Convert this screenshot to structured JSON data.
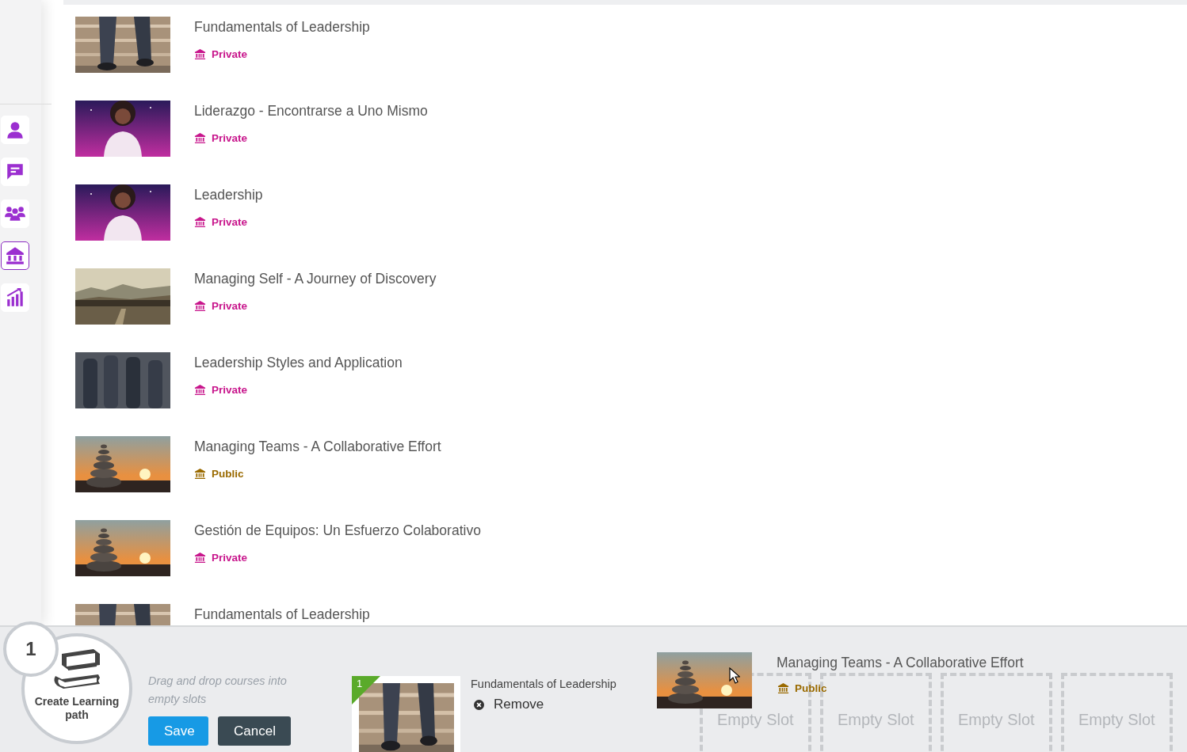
{
  "sidebar": {
    "items": [
      {
        "selected": false
      },
      {
        "selected": false
      },
      {
        "selected": false
      },
      {
        "selected": true
      },
      {
        "selected": false
      }
    ]
  },
  "courses": [
    {
      "title": "Fundamentals of Leadership",
      "visibility": {
        "label": "Private",
        "kind": "private"
      }
    },
    {
      "title": "Liderazgo - Encontrarse a Uno Mismo",
      "visibility": {
        "label": "Private",
        "kind": "private"
      }
    },
    {
      "title": "Leadership",
      "visibility": {
        "label": "Private",
        "kind": "private"
      }
    },
    {
      "title": "Managing Self - A Journey of Discovery",
      "visibility": {
        "label": "Private",
        "kind": "private"
      }
    },
    {
      "title": "Leadership Styles and Application",
      "visibility": {
        "label": "Private",
        "kind": "private"
      }
    },
    {
      "title": "Managing Teams - A Collaborative Effort",
      "visibility": {
        "label": "Public",
        "kind": "public"
      }
    },
    {
      "title": "Gestión de Equipos: Un Esfuerzo Colaborativo",
      "visibility": {
        "label": "Private",
        "kind": "private"
      }
    },
    {
      "title": "Fundamentals of Leadership"
    }
  ],
  "path_builder": {
    "step": "1",
    "title": "Create Learning path",
    "hint": "Drag and drop courses into empty slots",
    "buttons": [
      {
        "label": "Save",
        "kind": "primary"
      },
      {
        "label": "Cancel",
        "kind": "secondary"
      }
    ],
    "slots": [
      {
        "kind": "filled",
        "number": "1",
        "title": "Fundamentals of Leadership",
        "action": "Remove"
      },
      {
        "kind": "empty",
        "label": "Empty Slot"
      },
      {
        "kind": "empty",
        "label": "Empty Slot"
      },
      {
        "kind": "empty",
        "label": "Empty Slot"
      },
      {
        "kind": "empty",
        "label": "Empty Slot"
      }
    ],
    "dragged": {
      "title": "Managing Teams - A Collaborative Effort",
      "visibility": {
        "label": "Public",
        "kind": "public"
      }
    }
  }
}
